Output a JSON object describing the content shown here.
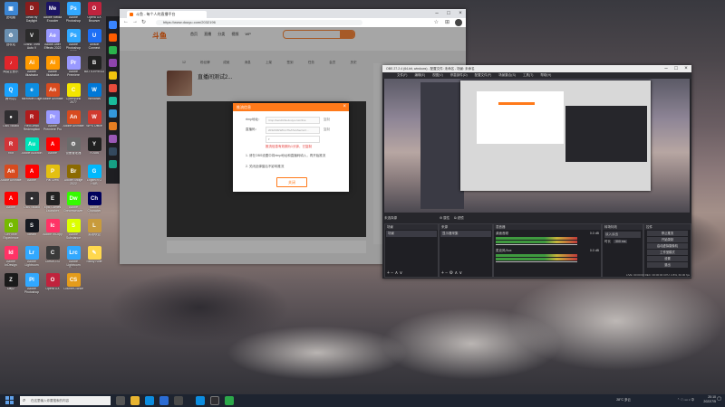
{
  "desktop": {
    "icons": [
      {
        "label": "此电脑",
        "color": "#3c86d4",
        "glyph": "▣"
      },
      {
        "label": "Dead by Daylight",
        "color": "#8a1c1c",
        "glyph": "D"
      },
      {
        "label": "Adobe Media Encoder",
        "color": "#1b1464",
        "glyph": "Me"
      },
      {
        "label": "Adobe Photoshop",
        "color": "#31a8ff",
        "glyph": "Ps"
      },
      {
        "label": "Opera GX Browser",
        "color": "#c0233d",
        "glyph": "O"
      },
      {
        "label": "回收站",
        "color": "#6a8fb0",
        "glyph": "♻"
      },
      {
        "label": "Grand Theft Auto V",
        "color": "#2b2b2b",
        "glyph": "V"
      },
      {
        "label": "Adobe After Effects 2022",
        "color": "#9999ff",
        "glyph": "Ae"
      },
      {
        "label": "Adobe Photoshop 2022",
        "color": "#31a8ff",
        "glyph": "Ps"
      },
      {
        "label": "Ubisoft Connect",
        "color": "#1e6ff5",
        "glyph": "U"
      },
      {
        "label": "网易云音乐",
        "color": "#e0262b",
        "glyph": "♪"
      },
      {
        "label": "Adobe Illustrator",
        "color": "#ff9a00",
        "glyph": "Ai"
      },
      {
        "label": "Adobe Illustrator",
        "color": "#ff9a00",
        "glyph": "Ai"
      },
      {
        "label": "Adobe Premiere",
        "color": "#9999ff",
        "glyph": "Pr"
      },
      {
        "label": "BATTLEFIELD",
        "color": "#222",
        "glyph": "B"
      },
      {
        "label": "腾讯QQ",
        "color": "#1aa3ff",
        "glyph": "Q"
      },
      {
        "label": "Microsoft Edge",
        "color": "#0c8de0",
        "glyph": "e"
      },
      {
        "label": "Adobe Animate",
        "color": "#d84b1f",
        "glyph": "An"
      },
      {
        "label": "Cyberpunk 2077",
        "color": "#f3e600",
        "glyph": "C"
      },
      {
        "label": "Windows",
        "color": "#0078d7",
        "glyph": "W"
      },
      {
        "label": "OBS Studio",
        "color": "#302e31",
        "glyph": "●"
      },
      {
        "label": "Red Dead Redemption",
        "color": "#b01c1c",
        "glyph": "R"
      },
      {
        "label": "Adobe Premiere Pro",
        "color": "#9999ff",
        "glyph": "Pr"
      },
      {
        "label": "Adobe Animate",
        "color": "#d84b1f",
        "glyph": "An"
      },
      {
        "label": "WPS Office",
        "color": "#d13a2e",
        "glyph": "W"
      },
      {
        "label": "Riot",
        "color": "#d13639",
        "glyph": "R"
      },
      {
        "label": "Adobe Audition",
        "color": "#00e4bb",
        "glyph": "Au"
      },
      {
        "label": "Adobe",
        "color": "#ff0000",
        "glyph": "A"
      },
      {
        "label": "设备管理器",
        "color": "#6b6b6b",
        "glyph": "⚙"
      },
      {
        "label": "YOUBI",
        "color": "#202020",
        "glyph": "Y"
      },
      {
        "label": "Adobe Animate",
        "color": "#d84b1f",
        "glyph": "An"
      },
      {
        "label": "Adobe",
        "color": "#ff0000",
        "glyph": "A"
      },
      {
        "label": "Pal Crew",
        "color": "#e4c010",
        "glyph": "P"
      },
      {
        "label": "Adobe Bridge 2022",
        "color": "#8b6a00",
        "glyph": "Br"
      },
      {
        "label": "Logitech G HUB",
        "color": "#00b8fc",
        "glyph": "G"
      },
      {
        "label": "Adobe",
        "color": "#ff0000",
        "glyph": "A"
      },
      {
        "label": "OBS Studio",
        "color": "#302e31",
        "glyph": "●"
      },
      {
        "label": "Epic Games Launcher",
        "color": "#222",
        "glyph": "E"
      },
      {
        "label": "Adobe Dreamweaver",
        "color": "#35fa00",
        "glyph": "Dw"
      },
      {
        "label": "Adobe Character Animator",
        "color": "#00005b",
        "glyph": "Ch"
      },
      {
        "label": "GeForce Experience",
        "color": "#76b900",
        "glyph": "G"
      },
      {
        "label": "Steam",
        "color": "#171a21",
        "glyph": "S"
      },
      {
        "label": "Adobe InCopy",
        "color": "#ff3366",
        "glyph": "Ic"
      },
      {
        "label": "Adobe Substance",
        "color": "#dcff00",
        "glyph": "S"
      },
      {
        "label": "英雄联盟",
        "color": "#c89b3c",
        "glyph": "L"
      },
      {
        "label": "Adobe InDesign",
        "color": "#ff3366",
        "glyph": "Id"
      },
      {
        "label": "Adobe Lightroom",
        "color": "#31a8ff",
        "glyph": "Lr"
      },
      {
        "label": "Cursor-GO",
        "color": "#3a3a3a",
        "glyph": "C"
      },
      {
        "label": "Adobe Lightroom Classic",
        "color": "#31a8ff",
        "glyph": "Lrc"
      },
      {
        "label": "Sticky Note",
        "color": "#ffd84d",
        "glyph": "✎"
      },
      {
        "label": "DayZ",
        "color": "#1a1a1a",
        "glyph": "Z"
      },
      {
        "label": "Adobe Photoshop",
        "color": "#31a8ff",
        "glyph": "Pl"
      },
      {
        "label": "Opera GX",
        "color": "#c0233d",
        "glyph": "O"
      },
      {
        "label": "Counter-Strike",
        "color": "#e49c1b",
        "glyph": "CS"
      }
    ]
  },
  "browser": {
    "tab_title": "斗鱼 - 每个人的直播平台",
    "url": "https://www.douyu.com/2032196",
    "site_logo": "斗鱼",
    "nav_items": [
      "首页",
      "直播",
      "分类",
      "视频",
      "WP"
    ],
    "search_placeholder": "",
    "shortcut_items": [
      "12",
      "粉丝牌",
      "成就",
      "消息",
      "上架",
      "签到",
      "任务",
      "会员",
      "历史"
    ],
    "room_title": "直播间测试2...",
    "dialog": {
      "title": "推流信息",
      "row1_label": "rtmp地址：",
      "row1_value": "rtmp://sendtc3a.douyu.com/live",
      "row2_label": "直播码：",
      "row2_value": "2032196rWKcx7fsA?wsSecret=...",
      "notice": "推流信息有效期为1分钟，已复制",
      "tip1": "1. 请在OBS设置中将rtmp地址和直播码填入，再开始推流",
      "tip2": "2. 关闭此弹窗后不影响推流",
      "confirm_label": "关闭"
    }
  },
  "obs": {
    "title": "OBS 27.2.4 (64-bit, windows) - 配置文件: 未命名 - 场景: 未命名",
    "menu": [
      "文件(F)",
      "编辑(E)",
      "视图(V)",
      "停靠部件(D)",
      "配置文件(P)",
      "场景集合(S)",
      "工具(T)",
      "帮助(H)"
    ],
    "scene_label": "未选择源",
    "docks": {
      "scenes": "场景",
      "sources": "来源",
      "mixer": "混音器",
      "transitions": "转场特效",
      "controls": "控件"
    },
    "scene_item": "场景",
    "source_item": "显示器采集",
    "mixer_items": [
      {
        "name": "桌面音频",
        "level": "0.0 dB"
      },
      {
        "name": "麦克风/Aux",
        "level": "0.0 dB"
      }
    ],
    "transition": "淡入淡出",
    "duration_label": "时长",
    "duration_value": "300 ms",
    "controls": [
      "停止推流",
      "开始录制",
      "启动虚拟摄像机",
      "工作室模式",
      "设置",
      "退出"
    ],
    "status": "LIVE: 00:00:03  REC: 00:00:00  CPU: 2.8%, 60.00 fps"
  },
  "taskbar": {
    "search_placeholder": "在这里输入你要搜索的内容",
    "weather": "28°C 多云",
    "time": "20:10",
    "date": "2022/7/5"
  }
}
